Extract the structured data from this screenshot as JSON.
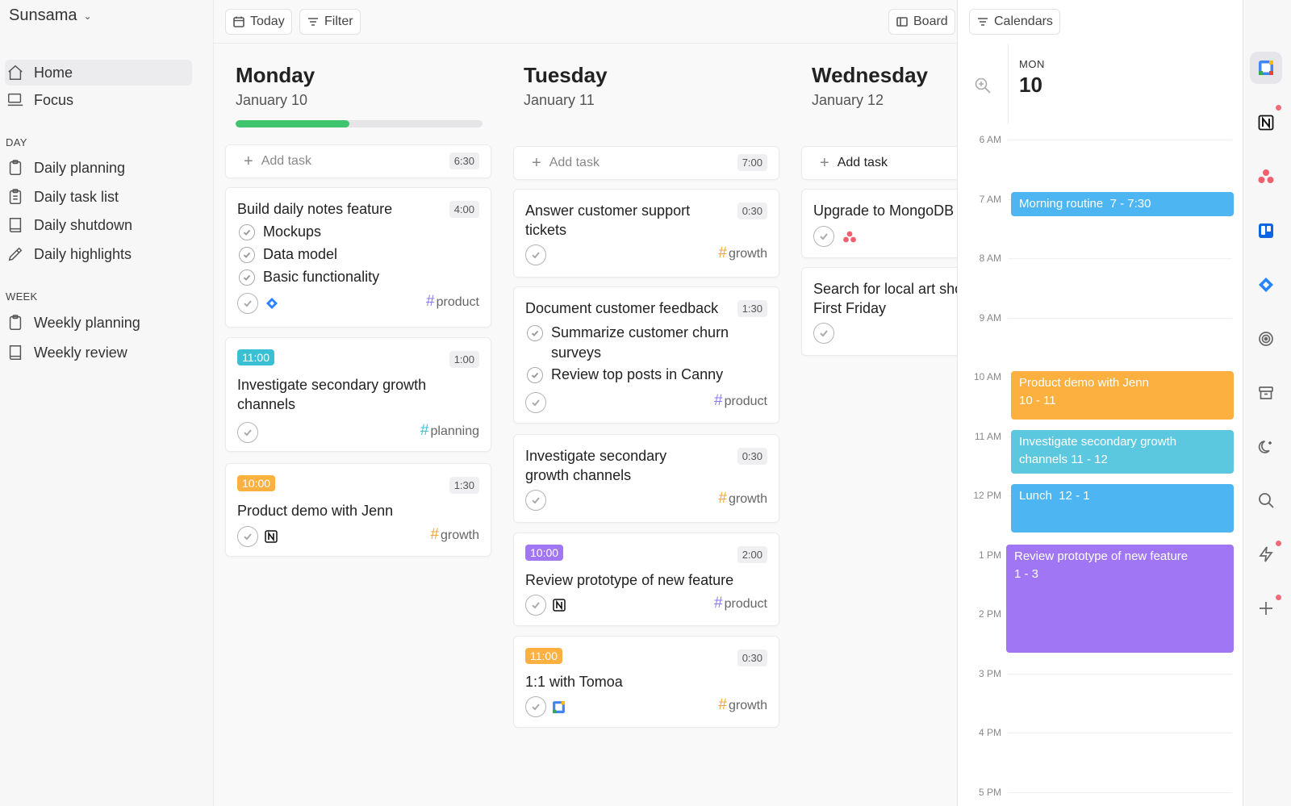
{
  "sidebar": {
    "workspace": "Sunsama",
    "home": "Home",
    "focus": "Focus",
    "day_section": "DAY",
    "daily_planning": "Daily planning",
    "daily_task_list": "Daily task list",
    "daily_shutdown": "Daily shutdown",
    "daily_highlights": "Daily highlights",
    "week_section": "WEEK",
    "weekly_planning": "Weekly planning",
    "weekly_review": "Weekly review"
  },
  "toolbar": {
    "today": "Today",
    "filter": "Filter",
    "board": "Board",
    "calendars": "Calendars"
  },
  "add_task_label": "Add task",
  "colors": {
    "progress_green": "#3ec56e",
    "teal_pill": "#39c0d4",
    "orange_pill": "#fbb040",
    "purple_pill": "#a176f5",
    "tag_hash": "#f0a63c"
  },
  "monday": {
    "name": "Monday",
    "date": "January 10",
    "progress": 0.46,
    "add_time": "6:30",
    "t1": {
      "title": "Build daily notes feature",
      "dur": "4:00",
      "sub1": "Mockups",
      "sub2": "Data model",
      "sub3": "Basic functionality",
      "tag": "product",
      "icon": "jira-icon"
    },
    "t2": {
      "time": "11:00",
      "dur": "1:00",
      "title_l1": "Investigate secondary growth",
      "title_l2": "channels",
      "tag": "planning"
    },
    "t3": {
      "time": "10:00",
      "dur": "1:30",
      "title": "Product demo with Jenn",
      "tag": "growth",
      "icon": "notion-icon"
    }
  },
  "tuesday": {
    "name": "Tuesday",
    "date": "January 11",
    "add_time": "7:00",
    "t1": {
      "title_l1": "Answer customer support",
      "title_l2": "tickets",
      "dur": "0:30",
      "tag": "growth"
    },
    "t2": {
      "title": "Document customer feedback",
      "dur": "1:30",
      "sub1_l1": "Summarize customer churn",
      "sub1_l2": "surveys",
      "sub2": "Review top posts in Canny",
      "tag": "product"
    },
    "t3": {
      "title_l1": "Investigate secondary",
      "title_l2": "growth channels",
      "dur": "0:30",
      "tag": "growth"
    },
    "t4": {
      "time": "10:00",
      "dur": "2:00",
      "title": "Review prototype of new feature",
      "tag": "product",
      "icon": "notion-icon"
    },
    "t5": {
      "time": "11:00",
      "dur": "0:30",
      "title": "1:1 with Tomoa",
      "tag": "growth",
      "icon": "google-calendar-icon"
    }
  },
  "wednesday": {
    "name": "Wednesday",
    "date": "January 12",
    "t1": {
      "title": "Upgrade to MongoDB",
      "icon": "asana-icon"
    },
    "t2": {
      "title_l1": "Search for local art show",
      "title_l2": "First Friday"
    }
  },
  "calendar": {
    "dow": "MON",
    "day_num": "10",
    "hours": [
      "6 AM",
      "7 AM",
      "8 AM",
      "9 AM",
      "10 AM",
      "11 AM",
      "12 PM",
      "1 PM",
      "2 PM",
      "3 PM",
      "4 PM",
      "5 PM"
    ],
    "events": [
      {
        "title": "Morning routine",
        "time": "7 - 7:30",
        "color": "#4db6f2"
      },
      {
        "title": "Product demo with Jenn",
        "time": "10 - 11",
        "color": "#fbb040"
      },
      {
        "title_l1": "Investigate secondary growth",
        "title_l2": "channels",
        "time": "11 - 12",
        "color": "#5bc8e0"
      },
      {
        "title": "Lunch",
        "time": "12 - 1",
        "color": "#4db6f2"
      },
      {
        "title": "Review prototype of new feature",
        "time": "1 - 3",
        "color": "#a176f5"
      }
    ]
  },
  "rail": [
    "google-calendar-icon",
    "notion-icon",
    "asana-icon",
    "trello-icon",
    "jira-icon",
    "target-icon",
    "archive-icon",
    "moon-icon",
    "search-icon",
    "bolt-icon",
    "plus-icon"
  ]
}
